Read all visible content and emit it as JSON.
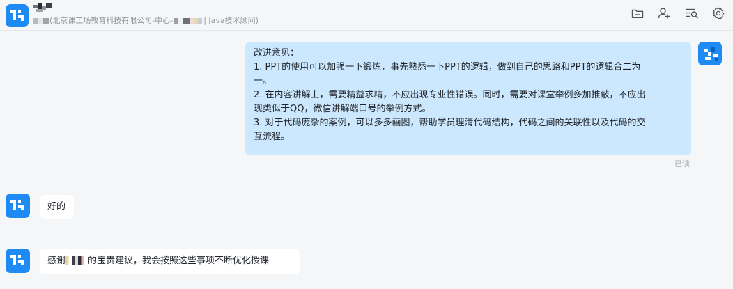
{
  "header": {
    "subtitle_prefix": "(北京课工场教育科技有限公司-中心-",
    "subtitle_suffix": "| Java技术顾问)",
    "icons": [
      "folder-icon",
      "add-user-icon",
      "search-history-icon",
      "settings-icon"
    ]
  },
  "messages": [
    {
      "from": "me",
      "lines": [
        "改进意见：",
        "1. PPT的使用可以加强一下锻炼，事先熟悉一下PPT的逻辑，做到自己的思路和PPT的逻辑合二为",
        "一。",
        "2. 在内容讲解上，需要精益求精，不应出现专业性错误。同时，需要对课堂举例多加推敲，不应出",
        "现类似于QQ，微信讲解端口号的举例方式。",
        "3. 对于代码庞杂的案例，可以多多画图，帮助学员理清代码结构，代码之间的关联性以及代码的交",
        "互流程。"
      ],
      "status": "已读"
    },
    {
      "from": "other",
      "text": "好的"
    },
    {
      "from": "other",
      "text_prefix": "感谢",
      "text_suffix": "的宝贵建议，我会按照这些事项不断优化授课"
    }
  ],
  "colors": {
    "background": "#f5f6f7",
    "my_bubble": "#cce8ff",
    "other_bubble": "#ffffff",
    "avatar": "#1e8bf5"
  }
}
